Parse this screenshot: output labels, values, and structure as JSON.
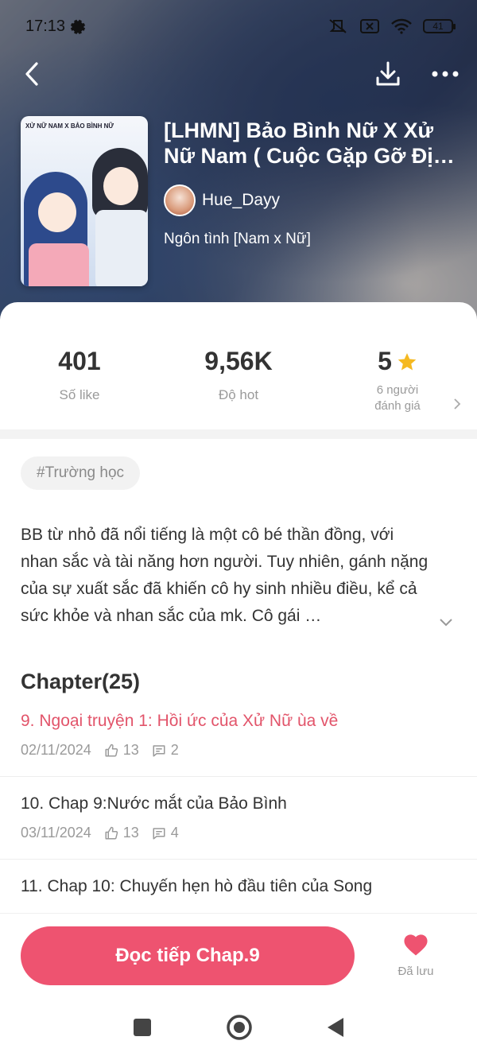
{
  "status_bar": {
    "time": "17:13",
    "battery": "41"
  },
  "book": {
    "cover_text": "XỬ NỮ NAM X BẢO BÌNH NỮ",
    "title": "[LHMN] Bảo Bình Nữ X Xử Nữ Nam ( Cuộc Gặp Gỡ Đị…",
    "author": "Hue_Dayy",
    "genre": "Ngôn tình [Nam x Nữ]"
  },
  "stats": {
    "likes": {
      "value": "401",
      "label": "Số like"
    },
    "hot": {
      "value": "9,56K",
      "label": "Độ hot"
    },
    "rating": {
      "value": "5",
      "label_line1": "6 người",
      "label_line2": "đánh giá"
    }
  },
  "tag": "#Trường học",
  "description": "BB từ nhỏ đã nổi tiếng là một cô bé thần đồng, với nhan sắc và tài năng hơn người. Tuy nhiên, gánh nặng của sự xuất sắc đã khiến cô hy sinh nhiều điều, kể cả sức khỏe và nhan sắc của mk. Cô gái …",
  "chapters_heading": "Chapter(25)",
  "chapters": [
    {
      "title": "9. Ngoại truyện 1: Hồi ức của Xử Nữ ùa về",
      "date": "02/11/2024",
      "likes": "13",
      "comments": "2"
    },
    {
      "title": "10. Chap 9:Nước mắt của Bảo Bình",
      "date": "03/11/2024",
      "likes": "13",
      "comments": "4"
    },
    {
      "title": "11. Chap 10: Chuyến hẹn hò đầu tiên của Song",
      "date": "",
      "likes": "",
      "comments": ""
    }
  ],
  "actions": {
    "read_label": "Đọc tiếp Chap.9",
    "saved_label": "Đã lưu"
  },
  "colors": {
    "accent": "#ee5370",
    "active_chapter": "#e2546a",
    "star": "#f5b921"
  }
}
